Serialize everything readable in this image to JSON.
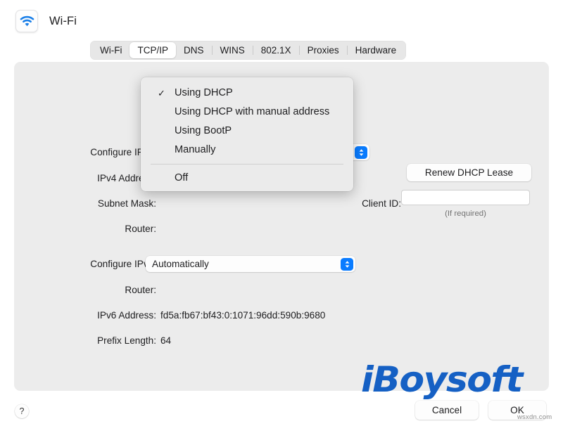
{
  "window": {
    "title": "Wi-Fi",
    "icon": "wifi-icon"
  },
  "tabs": [
    {
      "label": "Wi-Fi",
      "selected": false
    },
    {
      "label": "TCP/IP",
      "selected": true
    },
    {
      "label": "DNS",
      "selected": false
    },
    {
      "label": "WINS",
      "selected": false
    },
    {
      "label": "802.1X",
      "selected": false
    },
    {
      "label": "Proxies",
      "selected": false
    },
    {
      "label": "Hardware",
      "selected": false
    }
  ],
  "ipv4": {
    "configure_label": "Configure IPv4:",
    "configure_value": "Using DHCP",
    "address_label": "IPv4 Address:",
    "address_value": "",
    "subnet_label": "Subnet Mask:",
    "subnet_value": "",
    "router_label": "Router:",
    "router_value": "",
    "renew_button": "Renew DHCP Lease",
    "client_id_label": "Client ID:",
    "client_id_value": "",
    "client_id_placeholder": "",
    "client_id_hint": "(If required)"
  },
  "ipv6": {
    "configure_label": "Configure IPv6:",
    "configure_value": "Automatically",
    "router_label": "Router:",
    "router_value": "",
    "address_label": "IPv6 Address:",
    "address_value": "fd5a:fb67:bf43:0:1071:96dd:590b:9680",
    "prefix_label": "Prefix Length:",
    "prefix_value": "64"
  },
  "menu": {
    "items": [
      {
        "label": "Using DHCP",
        "checked": true
      },
      {
        "label": "Using DHCP with manual address",
        "checked": false
      },
      {
        "label": "Using BootP",
        "checked": false
      },
      {
        "label": "Manually",
        "checked": false
      },
      {
        "label": "Off",
        "checked": false,
        "after_separator": true
      }
    ],
    "check_glyph": "✓"
  },
  "footer": {
    "help_label": "?",
    "cancel_label": "Cancel",
    "ok_label": "OK"
  },
  "watermark": {
    "brand_i": "i",
    "brand_rest": "Boysoft",
    "site": "wsxdn.com"
  },
  "colors": {
    "accent": "#0a7cff",
    "panel": "#ececec",
    "menu": "#ebebeb",
    "watermark": "#1560c4"
  }
}
